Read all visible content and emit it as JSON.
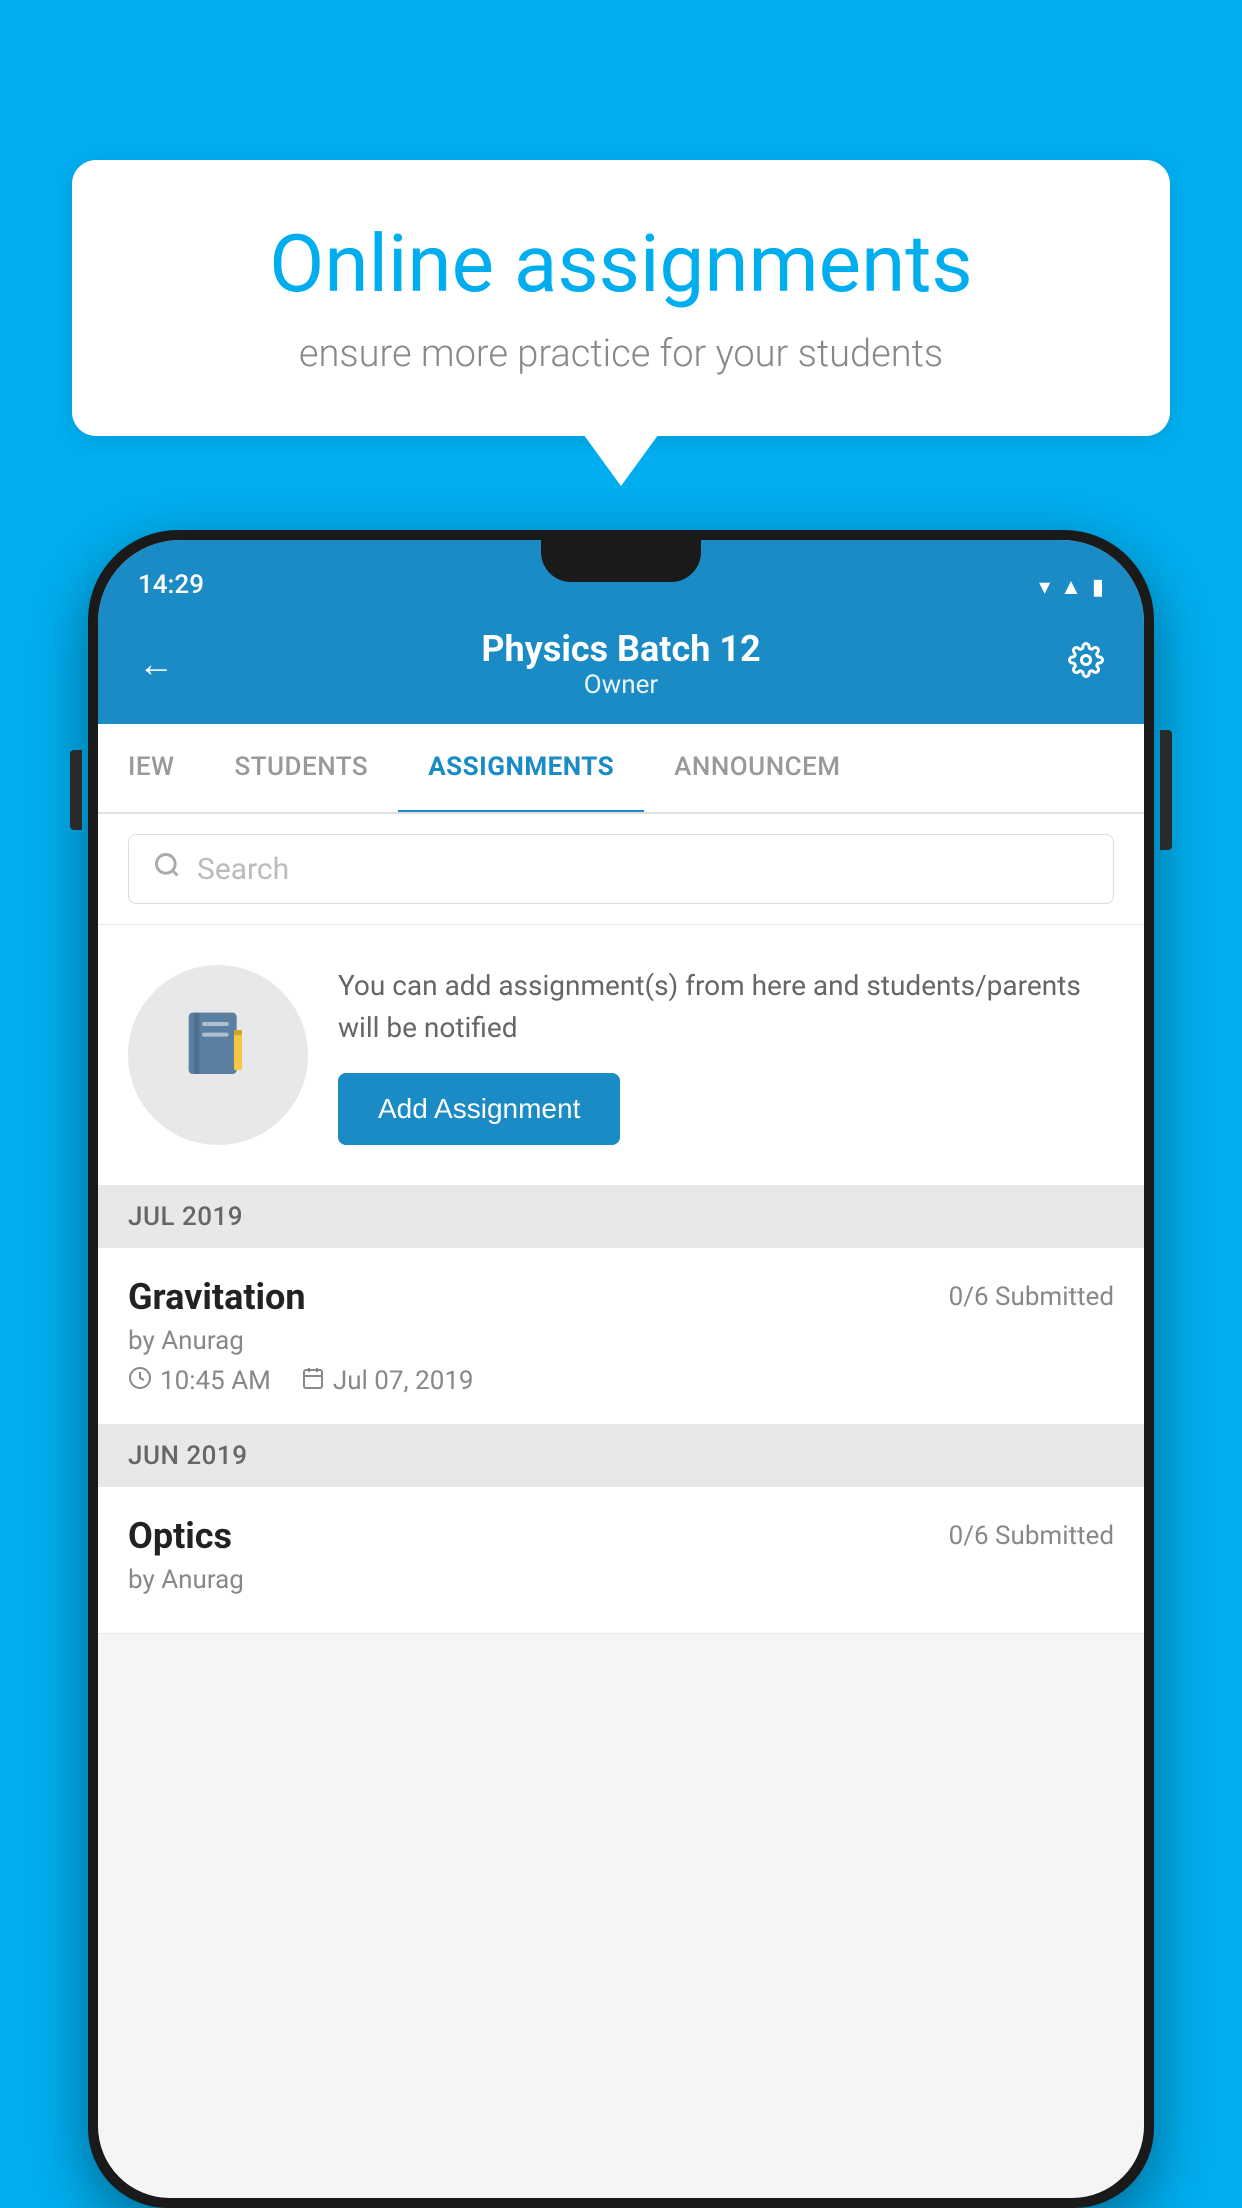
{
  "background_color": "#00AEEF",
  "speech_bubble": {
    "title": "Online assignments",
    "subtitle": "ensure more practice for your students"
  },
  "status_bar": {
    "time": "14:29",
    "icons": [
      "wifi",
      "signal",
      "battery"
    ]
  },
  "header": {
    "title": "Physics Batch 12",
    "subtitle": "Owner",
    "back_label": "←",
    "settings_label": "⚙"
  },
  "tabs": [
    {
      "label": "IEW",
      "active": false
    },
    {
      "label": "STUDENTS",
      "active": false
    },
    {
      "label": "ASSIGNMENTS",
      "active": true
    },
    {
      "label": "ANNOUNCEM",
      "active": false
    }
  ],
  "search": {
    "placeholder": "Search"
  },
  "promo": {
    "description": "You can add assignment(s) from here and students/parents will be notified",
    "button_label": "Add Assignment"
  },
  "sections": [
    {
      "month_label": "JUL 2019",
      "assignments": [
        {
          "name": "Gravitation",
          "submitted": "0/6 Submitted",
          "by": "by Anurag",
          "time": "10:45 AM",
          "date": "Jul 07, 2019"
        }
      ]
    },
    {
      "month_label": "JUN 2019",
      "assignments": [
        {
          "name": "Optics",
          "submitted": "0/6 Submitted",
          "by": "by Anurag",
          "time": "",
          "date": ""
        }
      ]
    }
  ]
}
